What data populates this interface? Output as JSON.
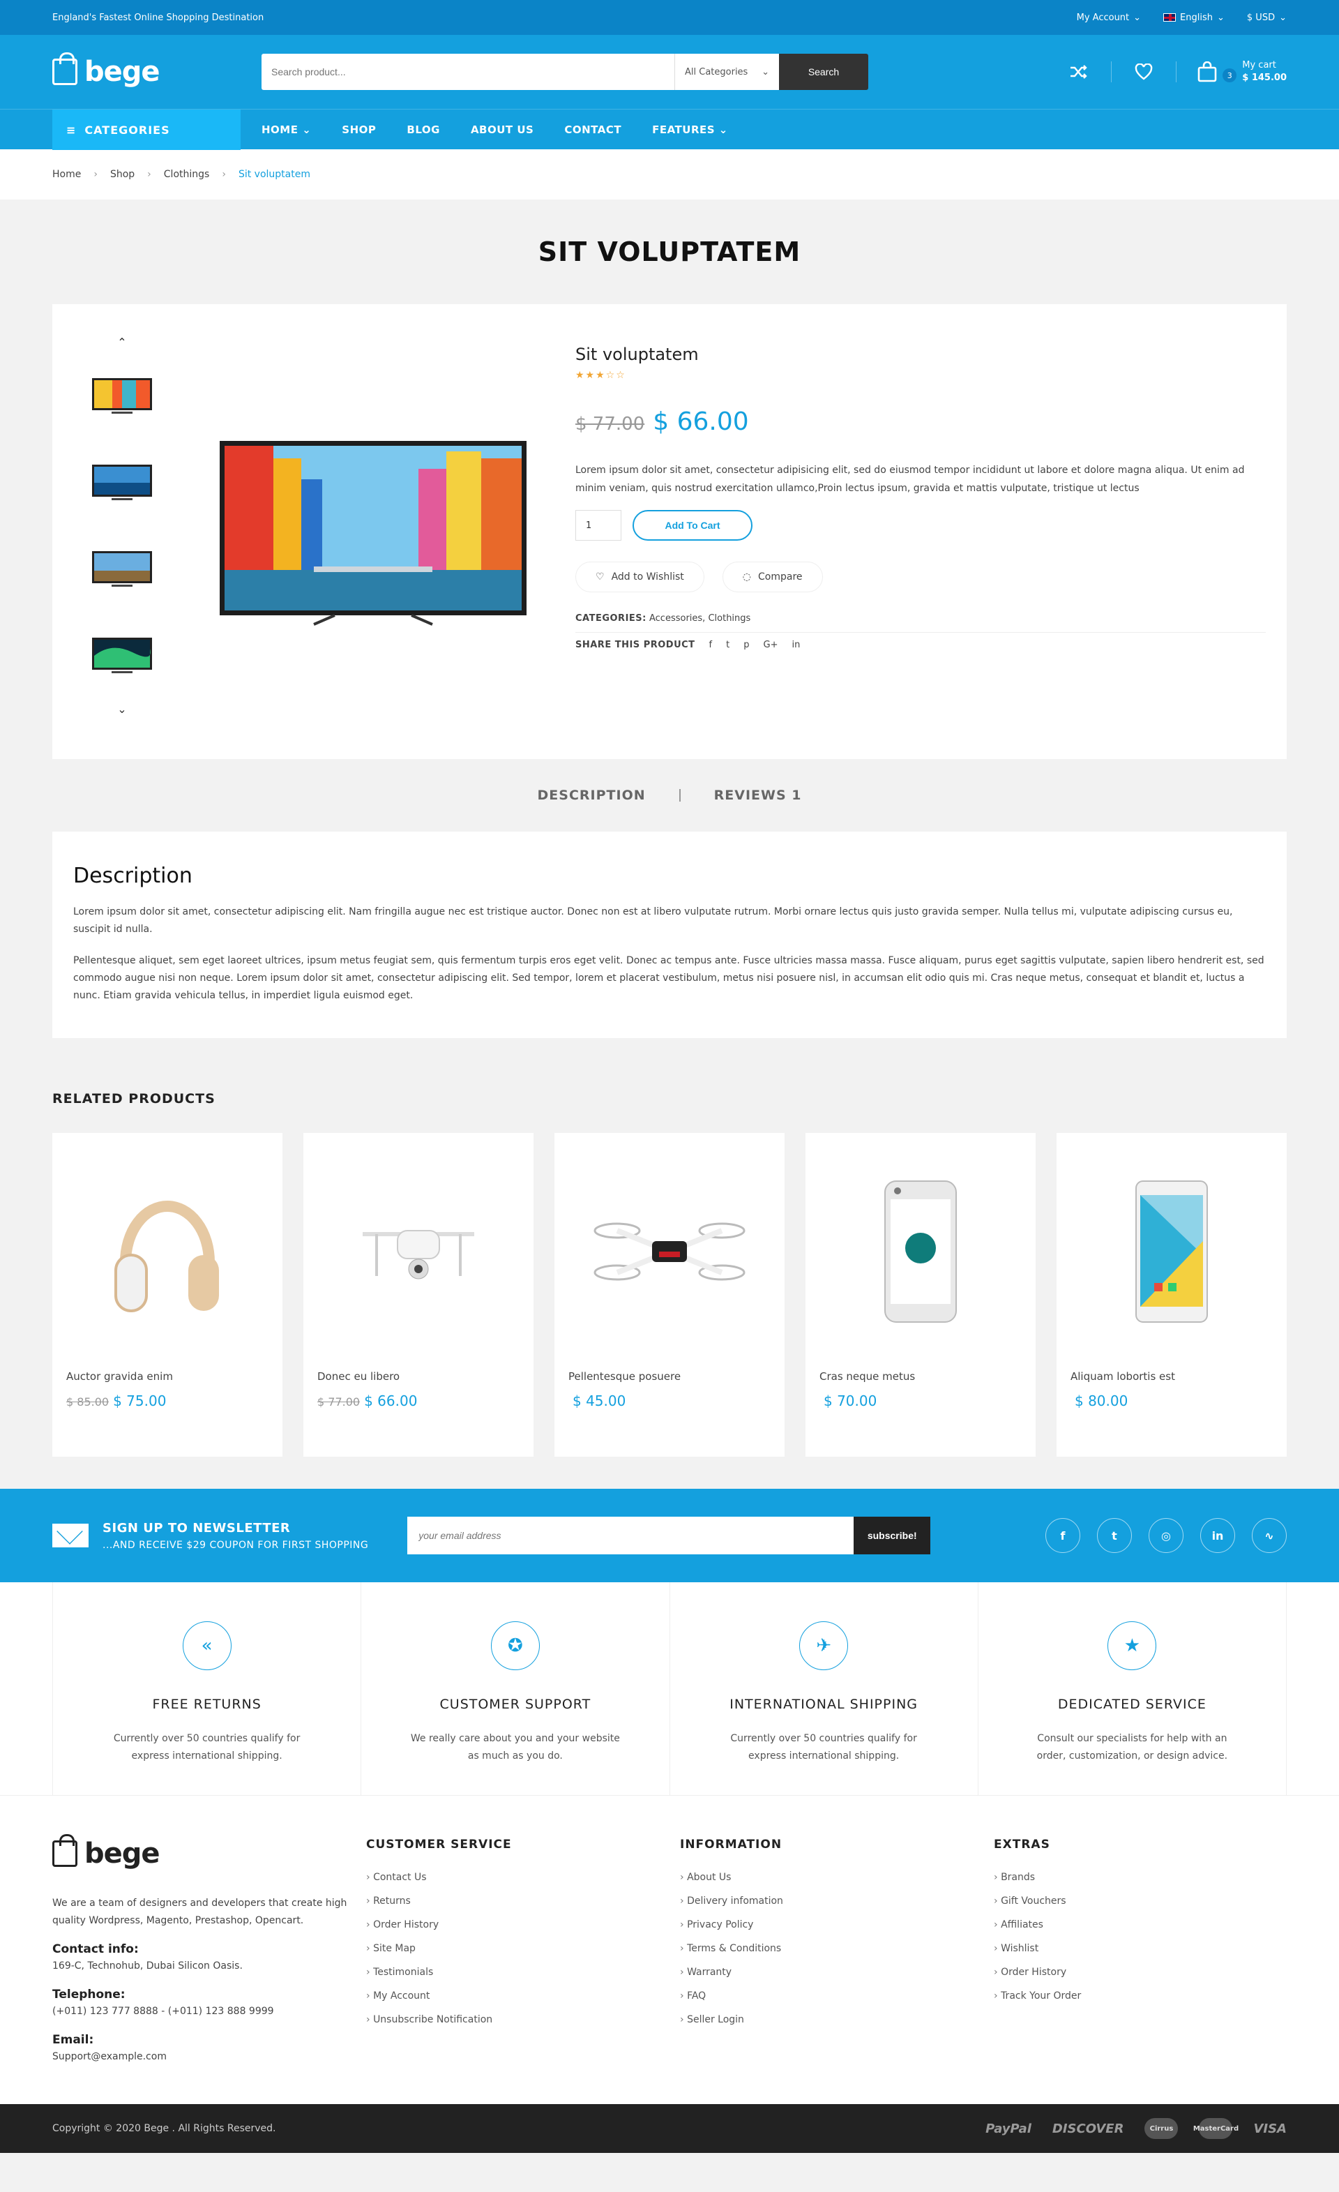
{
  "topbar": {
    "tagline": "England's Fastest Online Shopping Destination",
    "account": "My Account",
    "language": "English",
    "currency": "$ USD"
  },
  "header": {
    "logo": "bege",
    "search_placeholder": "Search product...",
    "search_category": "All Categories",
    "search_button": "Search",
    "cart_count": "3",
    "cart_label": "My cart",
    "cart_total": "$ 145.00"
  },
  "nav": {
    "categories": "CATEGORIES",
    "items": [
      "HOME",
      "SHOP",
      "BLOG",
      "ABOUT US",
      "CONTACT",
      "FEATURES"
    ]
  },
  "breadcrumb": [
    "Home",
    "Shop",
    "Clothings",
    "Sit voluptatem"
  ],
  "page_title": "SIT VOLUPTATEM",
  "product": {
    "name": "Sit voluptatem",
    "rating": 3.5,
    "stars_text": "★★★☆☆",
    "old_price": "$ 77.00",
    "new_price": "$ 66.00",
    "description": "Lorem ipsum dolor sit amet, consectetur adipisicing elit, sed do eiusmod tempor incididunt ut labore et dolore magna aliqua. Ut enim ad minim veniam, quis nostrud exercitation ullamco,Proin lectus ipsum, gravida et mattis vulputate, tristique ut lectus",
    "qty": "1",
    "add_to_cart": "Add To Cart",
    "wishlist": "Add to Wishlist",
    "compare": "Compare",
    "categories_label": "CATEGORIES:",
    "categories": "Accessories, Clothings",
    "share_label": "SHARE THIS PRODUCT"
  },
  "tabs": {
    "description": "DESCRIPTION",
    "reviews": "REVIEWS 1"
  },
  "description": {
    "heading": "Description",
    "p1": "Lorem ipsum dolor sit amet, consectetur adipiscing elit. Nam fringilla augue nec est tristique auctor. Donec non est at libero vulputate rutrum. Morbi ornare lectus quis justo gravida semper. Nulla tellus mi, vulputate adipiscing cursus eu, suscipit id nulla.",
    "p2": "Pellentesque aliquet, sem eget laoreet ultrices, ipsum metus feugiat sem, quis fermentum turpis eros eget velit. Donec ac tempus ante. Fusce ultricies massa massa. Fusce aliquam, purus eget sagittis vulputate, sapien libero hendrerit est, sed commodo augue nisi non neque. Lorem ipsum dolor sit amet, consectetur adipiscing elit. Sed tempor, lorem et placerat vestibulum, metus nisi posuere nisl, in accumsan elit odio quis mi. Cras neque metus, consequat et blandit et, luctus a nunc. Etiam gravida vehicula tellus, in imperdiet ligula euismod eget."
  },
  "related": {
    "heading": "RELATED PRODUCTS",
    "items": [
      {
        "name": "Auctor gravida enim",
        "old": "$ 85.00",
        "price": "$ 75.00"
      },
      {
        "name": "Donec eu libero",
        "old": "$ 77.00",
        "price": "$ 66.00"
      },
      {
        "name": "Pellentesque posuere",
        "old": "",
        "price": "$ 45.00"
      },
      {
        "name": "Cras neque metus",
        "old": "",
        "price": "$ 70.00"
      },
      {
        "name": "Aliquam lobortis est",
        "old": "",
        "price": "$ 80.00"
      }
    ]
  },
  "newsletter": {
    "title": "SIGN UP TO NEWSLETTER",
    "subtitle": "...AND RECEIVE $29 COUPON FOR FIRST SHOPPING",
    "placeholder": "your email address",
    "button": "subscribe!"
  },
  "features": [
    {
      "title": "FREE RETURNS",
      "text": "Currently over 50 countries qualify for express international shipping."
    },
    {
      "title": "CUSTOMER SUPPORT",
      "text": "We really care about you and your website as much as you do."
    },
    {
      "title": "INTERNATIONAL SHIPPING",
      "text": "Currently over 50 countries qualify for express international shipping."
    },
    {
      "title": "DEDICATED SERVICE",
      "text": "Consult our specialists for help with an order, customization, or design advice."
    }
  ],
  "footer": {
    "about": "We are a team of designers and developers that create high quality Wordpress, Magento, Prestashop, Opencart.",
    "contact_label": "Contact info:",
    "contact": "169-C, Technohub, Dubai Silicon Oasis.",
    "phone_label": "Telephone:",
    "phone": "(+011) 123 777 8888 - (+011) 123 888 9999",
    "email_label": "Email:",
    "email": "Support@example.com",
    "customer_service": {
      "title": "CUSTOMER SERVICE",
      "links": [
        "Contact Us",
        "Returns",
        "Order History",
        "Site Map",
        "Testimonials",
        "My Account",
        "Unsubscribe Notification"
      ]
    },
    "information": {
      "title": "INFORMATION",
      "links": [
        "About Us",
        "Delivery infomation",
        "Privacy Policy",
        "Terms & Conditions",
        "Warranty",
        "FAQ",
        "Seller Login"
      ]
    },
    "extras": {
      "title": "EXTRAS",
      "links": [
        "Brands",
        "Gift Vouchers",
        "Affiliates",
        "Wishlist",
        "Order History",
        "Track Your Order"
      ]
    }
  },
  "bottom": {
    "copyright": "Copyright © 2020 Bege . All Rights Reserved.",
    "payments": [
      "PayPal",
      "DISCOVER",
      "Cirrus",
      "MasterCard",
      "VISA"
    ]
  }
}
